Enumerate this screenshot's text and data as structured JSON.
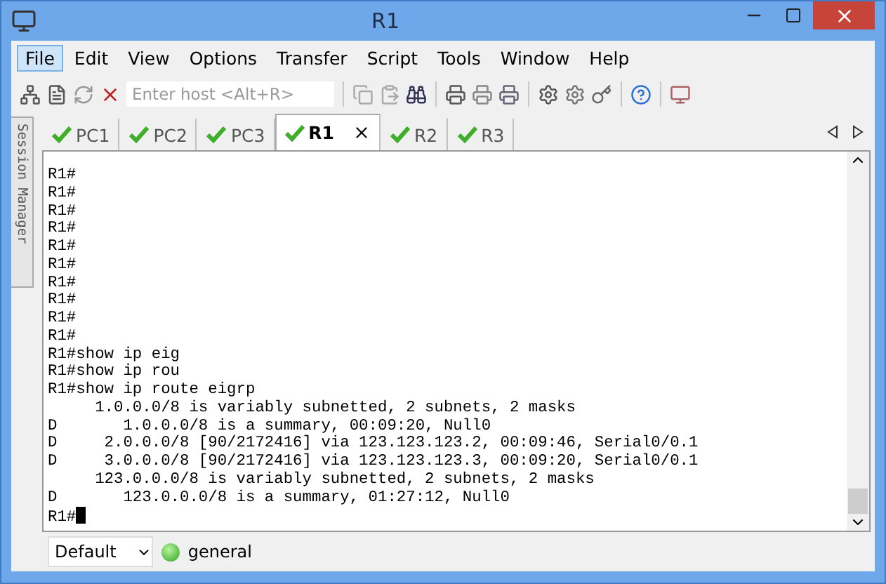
{
  "window": {
    "title": "R1"
  },
  "menu": [
    {
      "label": "File",
      "selected": true
    },
    {
      "label": "Edit",
      "selected": false
    },
    {
      "label": "View",
      "selected": false
    },
    {
      "label": "Options",
      "selected": false
    },
    {
      "label": "Transfer",
      "selected": false
    },
    {
      "label": "Script",
      "selected": false
    },
    {
      "label": "Tools",
      "selected": false
    },
    {
      "label": "Window",
      "selected": false
    },
    {
      "label": "Help",
      "selected": false
    }
  ],
  "toolbar": {
    "host_field": {
      "placeholder": "Enter host <Alt+R>"
    }
  },
  "side_panel": {
    "label": "Session Manager"
  },
  "tabs": [
    {
      "label": "PC1",
      "selected": false
    },
    {
      "label": "PC2",
      "selected": false
    },
    {
      "label": "PC3",
      "selected": false
    },
    {
      "label": "R1",
      "selected": true
    },
    {
      "label": "R2",
      "selected": false
    },
    {
      "label": "R3",
      "selected": false
    }
  ],
  "terminal": {
    "cursor": true,
    "lines": [
      "R1#",
      "R1#",
      "R1#",
      "R1#",
      "R1#",
      "R1#",
      "R1#",
      "R1#",
      "R1#",
      "R1#",
      "R1#show ip eig",
      "R1#show ip rou",
      "R1#show ip route eigrp",
      "     1.0.0.0/8 is variably subnetted, 2 subnets, 2 masks",
      "D       1.0.0.0/8 is a summary, 00:09:20, Null0",
      "D     2.0.0.0/8 [90/2172416] via 123.123.123.2, 00:09:46, Serial0/0.1",
      "D     3.0.0.0/8 [90/2172416] via 123.123.123.3, 00:09:20, Serial0/0.1",
      "     123.0.0.0/8 is variably subnetted, 2 subnets, 2 masks",
      "D       123.0.0.0/8 is a summary, 01:27:12, Null0",
      "R1#"
    ]
  },
  "status_bar": {
    "session": "Default",
    "status": "general"
  }
}
